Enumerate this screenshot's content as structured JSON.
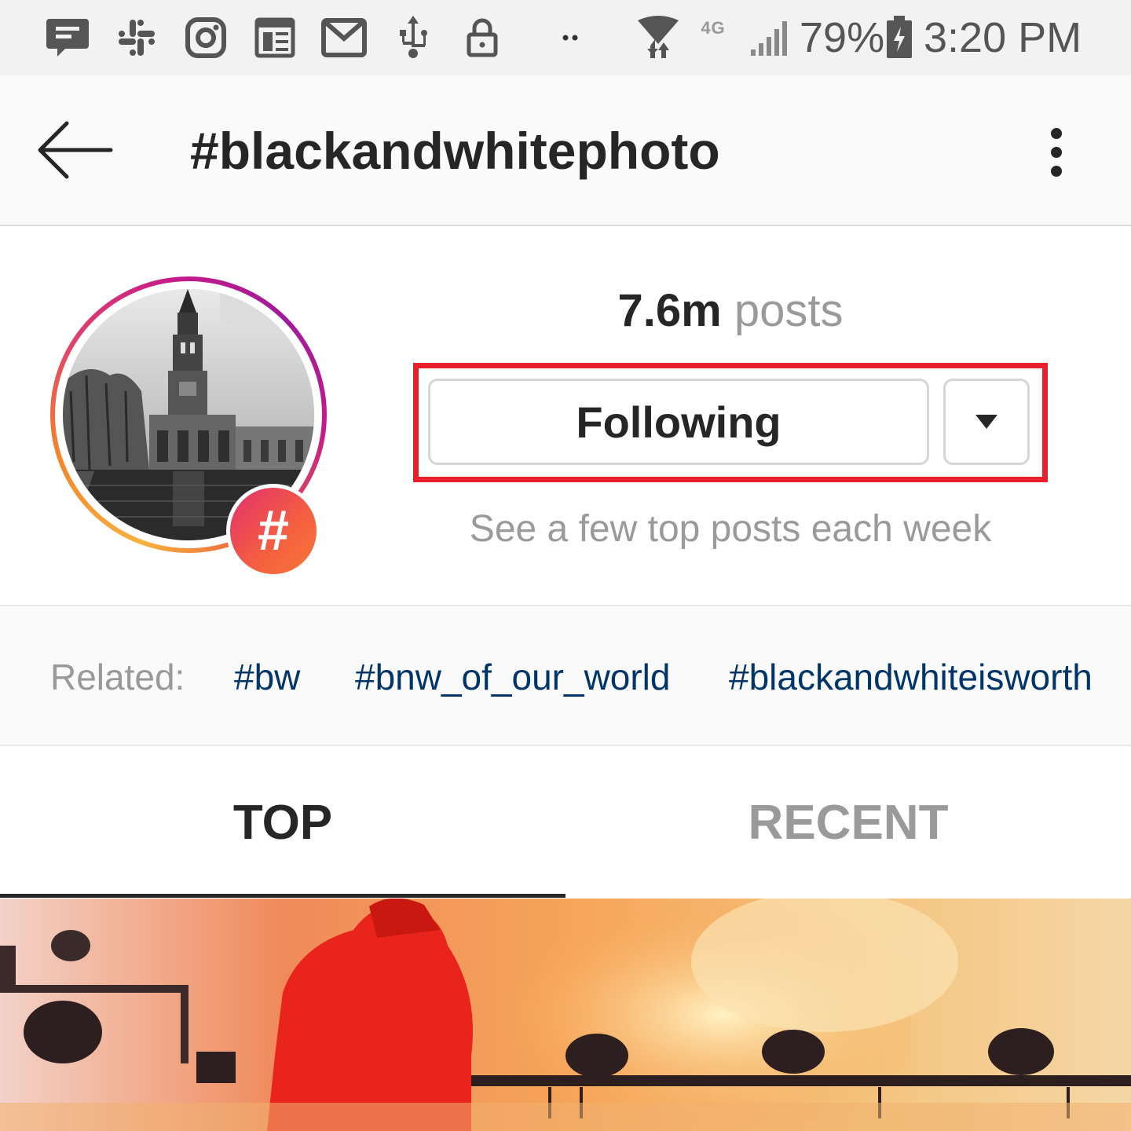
{
  "status_bar": {
    "icons": [
      "chat-icon",
      "slack-icon",
      "instagram-icon",
      "news-icon",
      "gmail-icon",
      "usb-icon",
      "lock-icon",
      "more-dots-icon",
      "wifi-icon",
      "network-4g-icon",
      "signal-icon",
      "battery-icon"
    ],
    "network_label": "4G",
    "battery": "79%",
    "time": "3:20 PM"
  },
  "header": {
    "back_icon": "arrow-left-icon",
    "title": "#blackandwhitephoto",
    "menu_icon": "more-vertical-icon"
  },
  "profile": {
    "avatar_badge": "#",
    "post_count": "7.6m",
    "post_label": "posts",
    "follow_button": "Following",
    "dropdown_icon": "triangle-down-icon",
    "subtext": "See a few top posts each week",
    "highlight_color": "#e8202c"
  },
  "related": {
    "label": "Related:",
    "tags": [
      "#bw",
      "#bnw_of_our_world",
      "#blackandwhiteisworth"
    ]
  },
  "tabs": [
    {
      "label": "TOP",
      "active": true
    },
    {
      "label": "RECENT",
      "active": false
    }
  ],
  "colors": {
    "link": "#003569",
    "muted": "#9a9a9a",
    "text": "#262626",
    "gradient_start": "#f58529",
    "gradient_end": "#c51b8a"
  }
}
